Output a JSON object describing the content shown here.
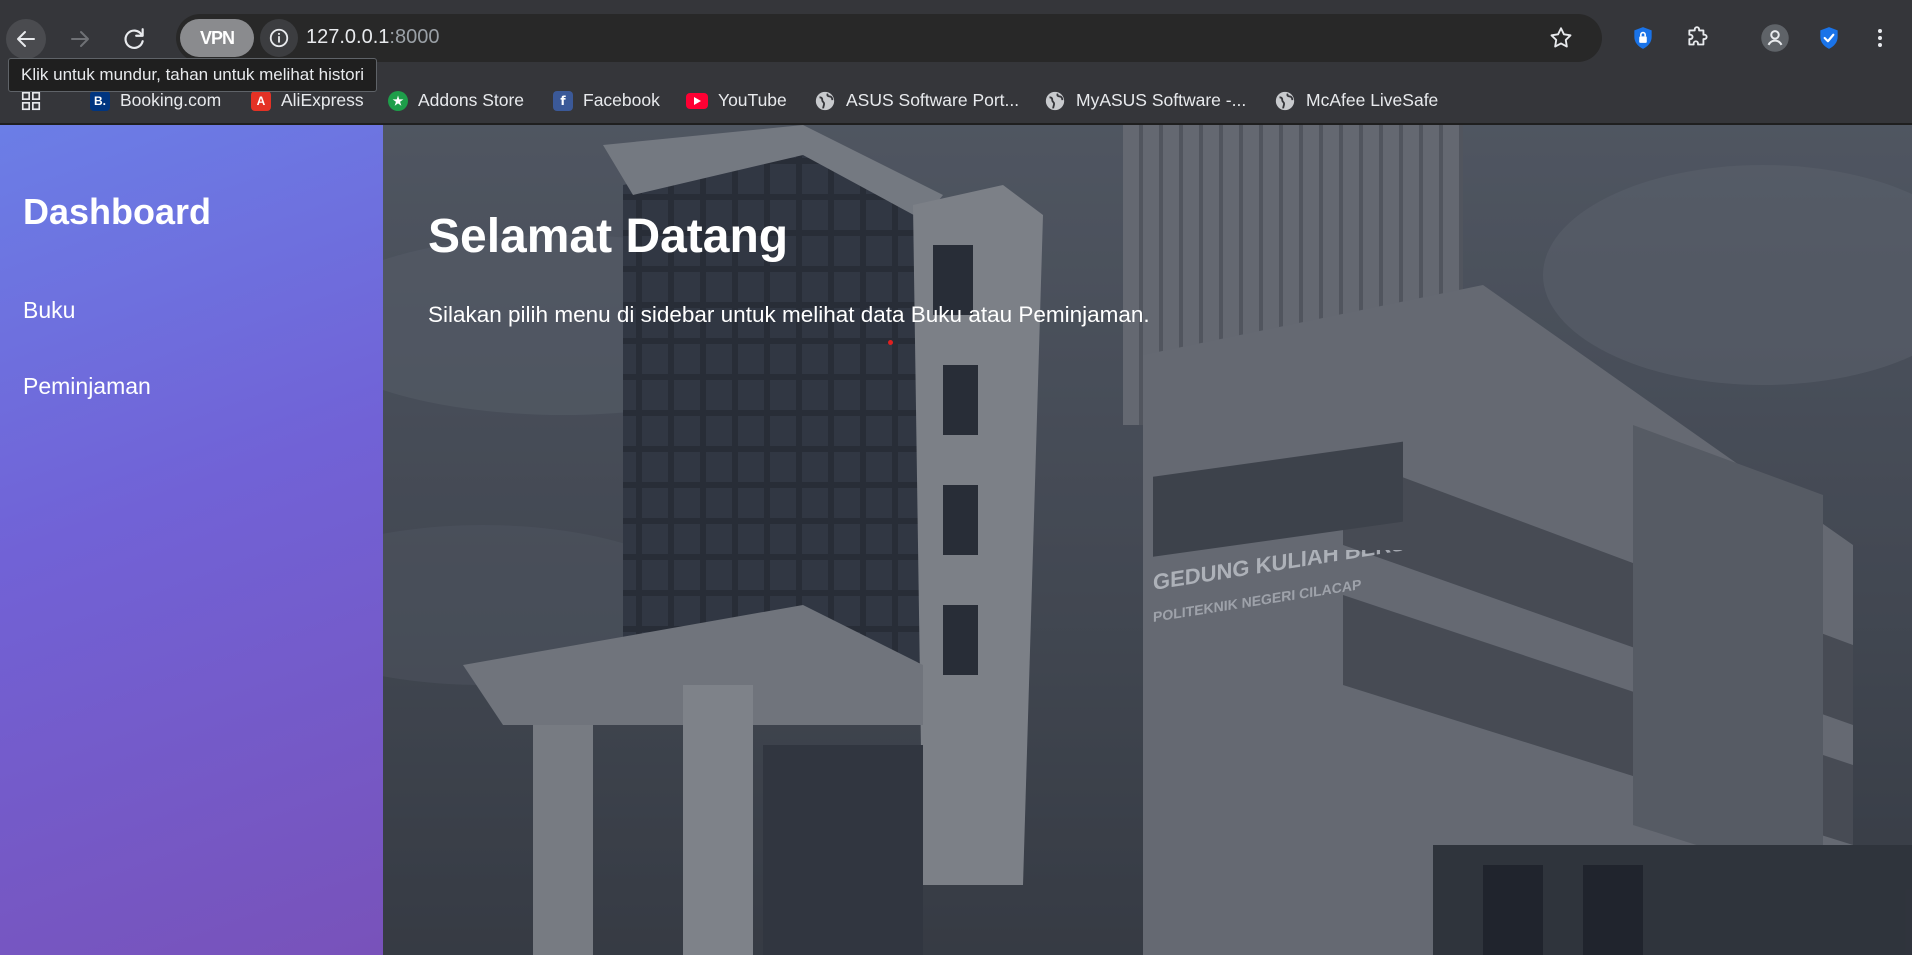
{
  "browser": {
    "url_host": "127.0.0.1",
    "url_port": ":8000",
    "vpn_label": "VPN",
    "tooltip": "Klik untuk mundur, tahan untuk melihat histori",
    "bookmarks": [
      {
        "label": "Booking.com",
        "icon": "booking-icon",
        "color": "#003580"
      },
      {
        "label": "AliExpress",
        "icon": "aliexpress-icon",
        "color": "#e43225"
      },
      {
        "label": "Addons Store",
        "icon": "addons-store-icon",
        "color": "#1e9e4a"
      },
      {
        "label": "Facebook",
        "icon": "facebook-icon",
        "color": "#3b5998"
      },
      {
        "label": "YouTube",
        "icon": "youtube-icon",
        "color": "#ff0033"
      },
      {
        "label": "ASUS Software Port...",
        "icon": "globe-icon",
        "color": "#9aa0a6"
      },
      {
        "label": "MyASUS Software -...",
        "icon": "globe-icon",
        "color": "#9aa0a6"
      },
      {
        "label": "McAfee LiveSafe",
        "icon": "globe-icon",
        "color": "#9aa0a6"
      }
    ]
  },
  "sidebar": {
    "title": "Dashboard",
    "items": [
      {
        "label": "Buku"
      },
      {
        "label": "Peminjaman"
      }
    ]
  },
  "main": {
    "heading": "Selamat Datang",
    "text": "Silakan pilih menu di sidebar untuk melihat data Buku atau Peminjaman.",
    "building_sign_line1": "GEDUNG KULIAH BERSAMA",
    "building_sign_line2": "POLITEKNIK NEGERI CILACAP"
  },
  "colors": {
    "sidebar_gradient_start": "#6b7ee6",
    "sidebar_gradient_end": "#7852ba",
    "chrome_bg": "#35363a"
  }
}
